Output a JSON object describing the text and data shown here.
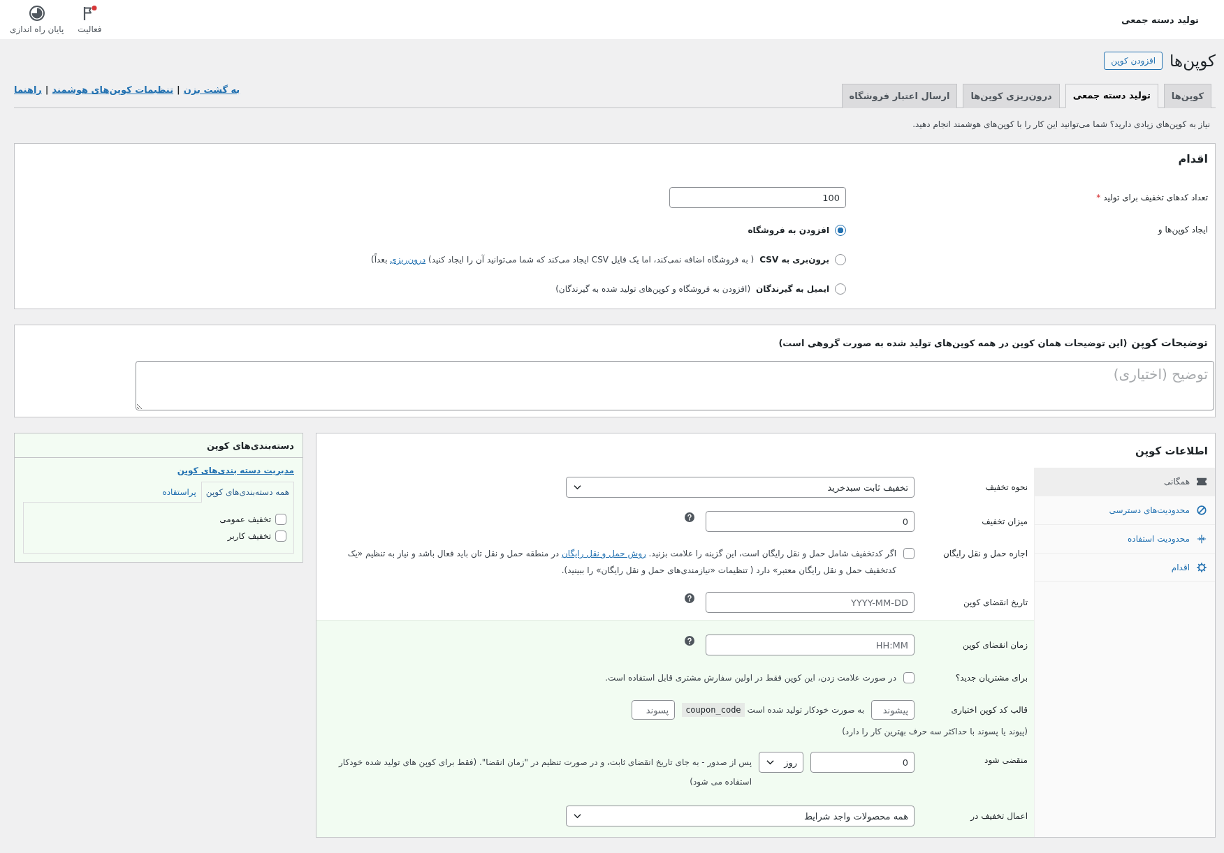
{
  "top_bar": {
    "title": "تولید دسته جمعی",
    "actions": [
      {
        "label": "فعالیت",
        "notification": true
      },
      {
        "label": "پایان راه اندازی",
        "notification": false
      }
    ]
  },
  "page_header": {
    "title": "کوپن‌ها",
    "add_button": "افزودن کوپن"
  },
  "tabs": [
    {
      "label": "کوپن‌ها",
      "selected": false
    },
    {
      "label": "تولید دسته جمعی",
      "selected": true
    },
    {
      "label": "درون‌ریزی کوپن‌ها",
      "selected": false
    },
    {
      "label": "ارسال اعتبار فروشگاه",
      "selected": false
    }
  ],
  "header_links": [
    "به گشت بزن",
    "تنظیمات کوپن‌های هوشمند",
    "راهنما"
  ],
  "link_separator": "|",
  "notice": "نیاز به کوپن‌های زیادی دارید؟ شما می‌توانید این کار را با کوپن‌های هوشمند انجام دهید.",
  "action_panel": {
    "title": "اقدام",
    "count": {
      "label": "تعداد کدهای تخفیف برای تولید",
      "required_mark": "*",
      "value": "100"
    },
    "mode_label": "ایجاد کوپن‌ها و",
    "modes": [
      {
        "label": "افزودن به فروشگاه",
        "selected": true
      },
      {
        "label": "برون‌بری به CSV",
        "selected": false,
        "note": [
          {
            "kind": "text",
            "text": "( به فروشگاه اضافه نمی‌کند، اما یک فایل CSV ایجاد می‌کند که شما می‌توانید آن را ایجاد کنید) "
          },
          {
            "kind": "link",
            "text": "درون‌ریزی"
          },
          {
            "kind": "text",
            "text": " بعداً)"
          }
        ]
      },
      {
        "label": "ایمیل به گیرندگان",
        "selected": false,
        "note": [
          {
            "kind": "text",
            "text": "(افزودن به فروشگاه و کوپن‌های تولید شده به گیرندگان)"
          }
        ]
      }
    ]
  },
  "description": {
    "title": "توضیحات کوپن",
    "hint": "(این توضیحات همان کوپن در همه کوپن‌های تولید شده به صورت گروهی است)",
    "placeholder": "توضیح (اختیاری)"
  },
  "coupon_data": {
    "title": "اطلاعات کوپن",
    "tabs": [
      {
        "label": "همگانی",
        "selected": true
      },
      {
        "label": "محدودیت‌های دسترسی",
        "selected": false
      },
      {
        "label": "محدودیت استفاده",
        "selected": false
      },
      {
        "label": "اقدام",
        "selected": false
      }
    ],
    "fields": [
      {
        "kind": "select",
        "label": "نحوه تخفیف",
        "value": "تخفیف ثابت سبدخرید",
        "highlighted": false
      },
      {
        "kind": "input",
        "label": "میزان تخفیف",
        "value": "0",
        "help": true,
        "highlighted": false
      },
      {
        "kind": "checkbox",
        "label": "اجازه حمل و نقل رایگان",
        "checked": false,
        "highlighted": false,
        "text": [
          {
            "kind": "text",
            "text": "اگر کدتخفیف شامل حمل و نقل رایگان است، این گزینه را علامت بزنید. "
          },
          {
            "kind": "link",
            "text": "روش حمل و نقل رایگان"
          },
          {
            "kind": "text",
            "text": " در منطقه حمل و نقل تان باید فعال باشد و نیاز به تنظیم «یک کدتخفیف حمل و نقل رایگان معتبر» دارد ( تنظیمات «نیازمندی‌های حمل و نقل رایگان» را ببینید)."
          }
        ]
      },
      {
        "kind": "input",
        "label": "تاریخ انقضای کوپن",
        "placeholder": "YYYY-MM-DD",
        "help": true,
        "highlighted": false
      },
      {
        "kind": "input",
        "label": "زمان انقضای کوپن",
        "placeholder": "HH:MM",
        "help": true,
        "highlighted": true
      },
      {
        "kind": "checkbox",
        "label": "برای مشتریان جدید؟",
        "checked": false,
        "highlighted": true,
        "text": [
          {
            "kind": "text",
            "text": "در صورت علامت زدن، این کوپن فقط در اولین سفارش مشتری قابل استفاده است."
          }
        ]
      },
      {
        "kind": "code_format",
        "label": "قالب کد کوپن اختیاری",
        "prefix_placeholder": "پیشوند",
        "middle": "به صورت خودکار تولید شده است",
        "code": "coupon_code",
        "suffix_placeholder": "پسوند",
        "hint": "(پیوند یا پسوند با حداکثر سه حرف بهترین کار را دارد)",
        "highlighted": true
      },
      {
        "kind": "expiry",
        "label": "منقضی شود",
        "value": "0",
        "unit": "روز",
        "text": "پس از صدور - به جای تاریخ انقضای ثابت، و در صورت تنظیم در \"زمان انقضا\". (فقط برای کوپن های تولید شده خودکار استفاده می شود)",
        "highlighted": true
      },
      {
        "kind": "select",
        "label": "اعمال تخفیف در",
        "value": "همه محصولات واجد شرایط",
        "highlighted": true
      }
    ]
  },
  "categories": {
    "title": "دسته‌بندی‌های کوپن",
    "manage_link": "مدیریت دسته بندی‌های کوپن",
    "tabs": [
      {
        "label": "همه دسته‌بندی‌های کوپن",
        "selected": true
      },
      {
        "label": "پراستفاده",
        "selected": false
      }
    ],
    "items": [
      {
        "label": "تخفیف عمومی",
        "checked": false
      },
      {
        "label": "تخفیف کاربر",
        "checked": false
      }
    ]
  }
}
